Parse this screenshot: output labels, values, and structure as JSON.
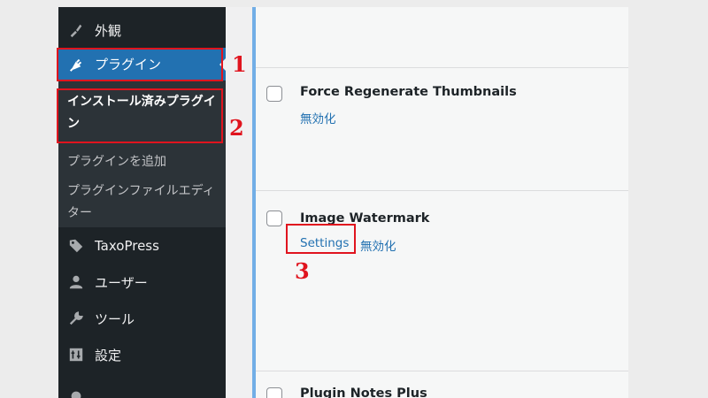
{
  "sidebar": {
    "appearance": {
      "label": "外観",
      "icon": "brush-icon"
    },
    "plugins": {
      "label": "プラグイン",
      "icon": "plugin-icon"
    },
    "submenu": {
      "installed": "インストール済みプラグイン",
      "add_new": "プラグインを追加",
      "editor": "プラグインファイルエディター"
    },
    "taxopress": {
      "label": "TaxoPress",
      "icon": "tag-icon"
    },
    "users": {
      "label": "ユーザー",
      "icon": "user-icon"
    },
    "tools": {
      "label": "ツール",
      "icon": "wrench-icon"
    },
    "settings": {
      "label": "設定",
      "icon": "settings-icon"
    }
  },
  "plugins_list": {
    "rows": [
      {
        "name": "Force Regenerate Thumbnails",
        "actions": [
          "無効化"
        ]
      },
      {
        "name": "Image Watermark",
        "actions": [
          "Settings",
          "無効化"
        ]
      },
      {
        "name": "Plugin Notes Plus",
        "actions": []
      }
    ]
  },
  "annotations": {
    "step1": "1",
    "step2": "2",
    "step3": "3",
    "color": "#e0141e"
  },
  "colors": {
    "sidebar_bg": "#1d2327",
    "submenu_bg": "#2c3338",
    "active_bg": "#2271b1",
    "link": "#2271b1"
  }
}
